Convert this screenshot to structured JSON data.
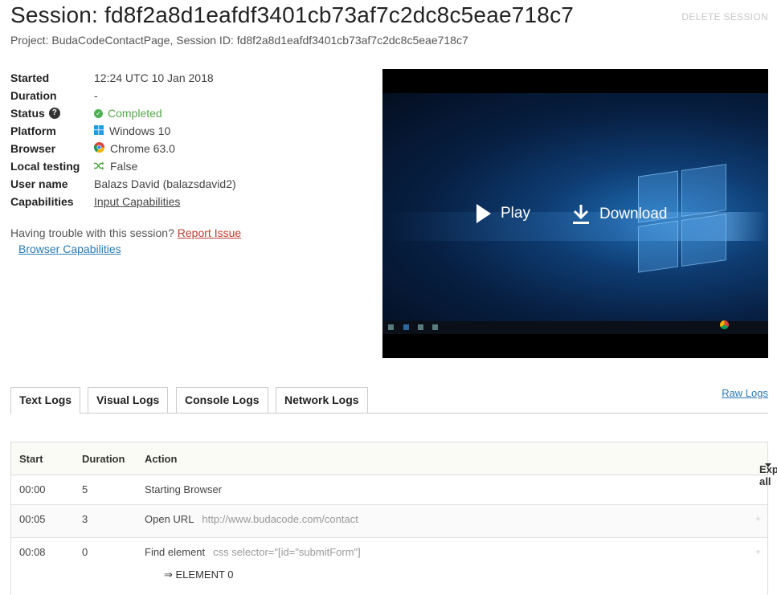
{
  "header": {
    "title": "Session: fd8f2a8d1eafdf3401cb73af7c2dc8c5eae718c7",
    "delete_label": "DELETE SESSION",
    "subtitle": "Project: BudaCodeContactPage, Session ID: fd8f2a8d1eafdf3401cb73af7c2dc8c5eae718c7"
  },
  "details": {
    "started": {
      "label": "Started",
      "value": "12:24 UTC 10 Jan 2018"
    },
    "duration": {
      "label": "Duration",
      "value": "-"
    },
    "status": {
      "label": "Status",
      "help": "?",
      "value": "Completed",
      "color": "#57a64a"
    },
    "platform": {
      "label": "Platform",
      "value": "Windows 10",
      "icon": "windows-icon"
    },
    "browser": {
      "label": "Browser",
      "value": "Chrome 63.0",
      "icon": "chrome-icon"
    },
    "local_testing": {
      "label": "Local testing",
      "value": "False",
      "icon": "shuffle-icon"
    },
    "username": {
      "label": "User name",
      "value": "Balazs David (balazsdavid2)"
    },
    "capabilities": {
      "label": "Capabilities",
      "link": "Input Capabilities"
    }
  },
  "trouble": {
    "text": "Having trouble with this session?",
    "report_link": "Report Issue",
    "browser_caps_link": "Browser Capabilities"
  },
  "video": {
    "play_label": "Play",
    "download_label": "Download"
  },
  "tabs": [
    {
      "label": "Text Logs",
      "active": true
    },
    {
      "label": "Visual Logs"
    },
    {
      "label": "Console Logs"
    },
    {
      "label": "Network Logs"
    }
  ],
  "raw_logs_label": "Raw Logs",
  "log_table": {
    "headers": {
      "start": "Start",
      "duration": "Duration",
      "action": "Action",
      "expand_all": "Expand all"
    },
    "rows": [
      {
        "start": "00:00",
        "duration": "5",
        "action": "Starting Browser",
        "detail": ""
      },
      {
        "start": "00:05",
        "duration": "3",
        "action": "Open URL",
        "detail": "http://www.budacode.com/contact"
      },
      {
        "start": "00:08",
        "duration": "0",
        "action": "Find element",
        "detail": "css selector=\"[id=\"submitForm\"]",
        "result": "⇒  ELEMENT 0"
      }
    ]
  },
  "colors": {
    "link": "#2a7ab8",
    "report": "#c0392b",
    "completed": "#57a64a"
  }
}
